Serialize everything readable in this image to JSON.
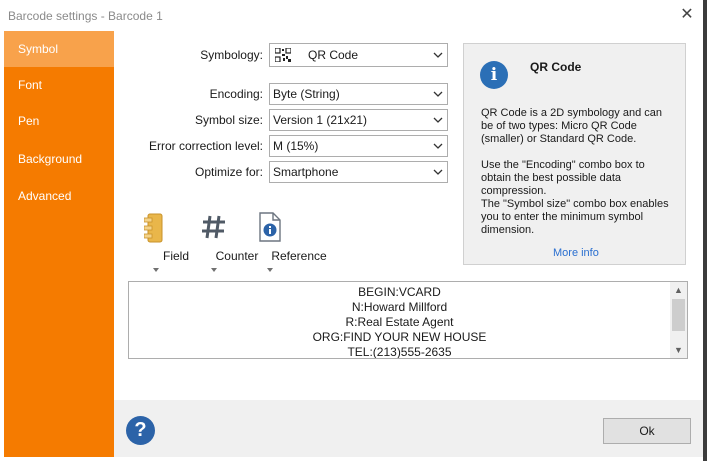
{
  "window": {
    "title": "Barcode settings - Barcode 1",
    "close_glyph": "✕"
  },
  "sidebar": {
    "items": [
      {
        "label": "Symbol",
        "active": true
      },
      {
        "label": "Font"
      },
      {
        "label": "Pen"
      },
      {
        "label": "Background"
      },
      {
        "label": "Advanced"
      }
    ]
  },
  "form": {
    "symbology": {
      "label": "Symbology:",
      "value": "QR Code",
      "icon": "qr-code-icon"
    },
    "encoding": {
      "label": "Encoding:",
      "value": "Byte (String)"
    },
    "symbol_size": {
      "label": "Symbol size:",
      "value": "Version  1 (21x21)"
    },
    "error_correction": {
      "label": "Error correction level:",
      "value": "M (15%)"
    },
    "optimize_for": {
      "label": "Optimize for:",
      "value": "Smartphone"
    }
  },
  "info_panel": {
    "title": "QR Code",
    "icon": "info-icon",
    "paragraph1": "QR Code is a 2D symbology and can be of two types: Micro QR Code (smaller) or Standard QR Code.",
    "paragraph2": "Use the \"Encoding\" combo box to obtain the best possible data compression.",
    "paragraph3": "The \"Symbol size\" combo box enables you to enter the minimum symbol dimension.",
    "link": "More info"
  },
  "tools": [
    {
      "label": "Field",
      "icon": "field-icon"
    },
    {
      "label": "Counter",
      "icon": "hash-icon"
    },
    {
      "label": "Reference",
      "icon": "reference-icon"
    }
  ],
  "content": {
    "lines": [
      "BEGIN:VCARD",
      "N:Howard Millford",
      "R:Real Estate Agent",
      "ORG:FIND YOUR NEW HOUSE",
      "TEL:(213)555-2635"
    ]
  },
  "footer": {
    "ok_label": "Ok",
    "help_glyph": "?"
  },
  "colors": {
    "sidebar": "#f57b00",
    "sidebar_active": "#f8a24b",
    "link": "#2a6fd0",
    "help": "#2c63a8"
  }
}
